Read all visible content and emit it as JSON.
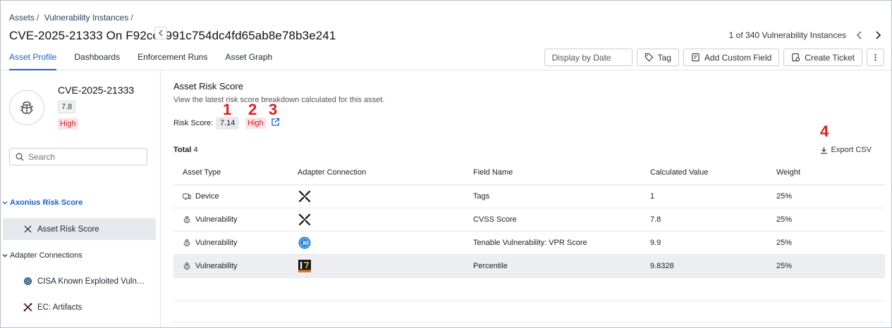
{
  "breadcrumb": {
    "items": [
      "Assets",
      "Vulnerability Instances"
    ],
    "separator": "/"
  },
  "page": {
    "title": "CVE-2025-21333 On F92cec991c754dc4fd65ab8e78b3e241"
  },
  "pager": {
    "text": "1 of 340 Vulnerability Instances"
  },
  "tabs": [
    {
      "label": "Asset Profile",
      "active": true
    },
    {
      "label": "Dashboards",
      "active": false
    },
    {
      "label": "Enforcement Runs",
      "active": false
    },
    {
      "label": "Asset Graph",
      "active": false
    }
  ],
  "toolbar": {
    "date_placeholder": "Display by Date",
    "tag_label": "Tag",
    "custom_field_label": "Add Custom Field",
    "ticket_label": "Create Ticket"
  },
  "sidebar": {
    "asset_name": "CVE-2025-21333",
    "score": "7.8",
    "severity": "High",
    "search_placeholder": "Search",
    "groups": [
      {
        "label": "Axonius Risk Score",
        "items": [
          "Asset Risk Score"
        ]
      },
      {
        "label": "Adapter Connections",
        "items": [
          "CISA Known Exploited Vulnerabilities",
          "EC: Artifacts"
        ]
      }
    ]
  },
  "main": {
    "title": "Asset Risk Score",
    "description": "View the latest risk score breakdown calculated for this asset.",
    "risk_label": "Risk Score:",
    "risk_value": "7.14",
    "risk_severity": "High",
    "total_label": "Total",
    "total_count": "4",
    "export_label": "Export CSV",
    "annotations": [
      "1",
      "2",
      "3",
      "4"
    ]
  },
  "table": {
    "columns": [
      "Asset Type",
      "Adapter Connection",
      "Field Name",
      "Calculated Value",
      "Weight"
    ],
    "rows": [
      {
        "asset_type": "Device",
        "adapter_icon": "axonius-x-logo",
        "field": "Tags",
        "value": "1",
        "weight": "25%"
      },
      {
        "asset_type": "Vulnerability",
        "adapter_icon": "axonius-x-logo",
        "field": "CVSS Score",
        "value": "7.8",
        "weight": "25%"
      },
      {
        "asset_type": "Vulnerability",
        "adapter_icon": "tenable-io-logo",
        "field": "Tenable Vulnerability: VPR Score",
        "value": "9.9",
        "weight": "25%"
      },
      {
        "asset_type": "Vulnerability",
        "adapter_icon": "epss-logo",
        "field": "Percentile",
        "value": "9.8328",
        "weight": "25%"
      }
    ]
  },
  "colors": {
    "accent": "#1c5fce",
    "danger": "#c4252f",
    "danger_bg": "#fbe2e4",
    "annotation": "#e02020"
  }
}
